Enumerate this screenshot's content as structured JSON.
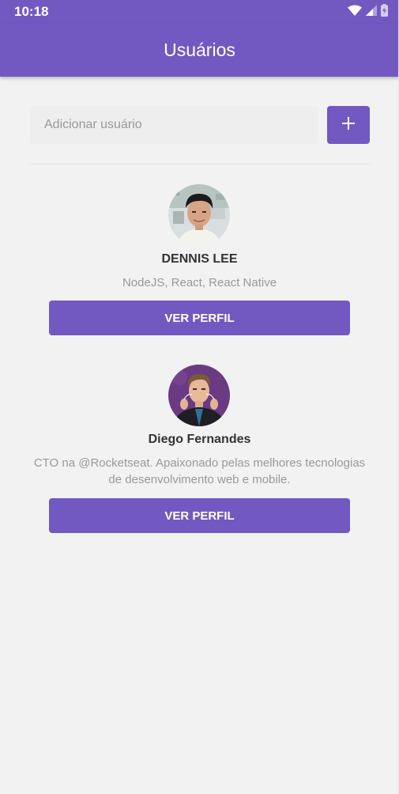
{
  "status_bar": {
    "time": "10:18",
    "icons": [
      "wifi-icon",
      "cellular-signal-icon",
      "battery-charging-icon"
    ]
  },
  "header": {
    "title": "Usuários"
  },
  "form": {
    "input_value": "",
    "input_placeholder": "Adicionar usuário",
    "add_icon": "plus-icon"
  },
  "users": [
    {
      "name": "DENNIS LEE",
      "bio": "NodeJS, React, React Native",
      "button_label": "VER PERFIL"
    },
    {
      "name": "Diego Fernandes",
      "bio": "CTO na @Rocketseat. Apaixonado pelas melhores tecnologias de desenvolvimento web e mobile.",
      "button_label": "VER PERFIL"
    }
  ],
  "colors": {
    "primary": "#7159c1",
    "background": "#f2f2f2",
    "input_background": "#eeeeee",
    "name_text": "#333333",
    "bio_text": "#999999"
  }
}
